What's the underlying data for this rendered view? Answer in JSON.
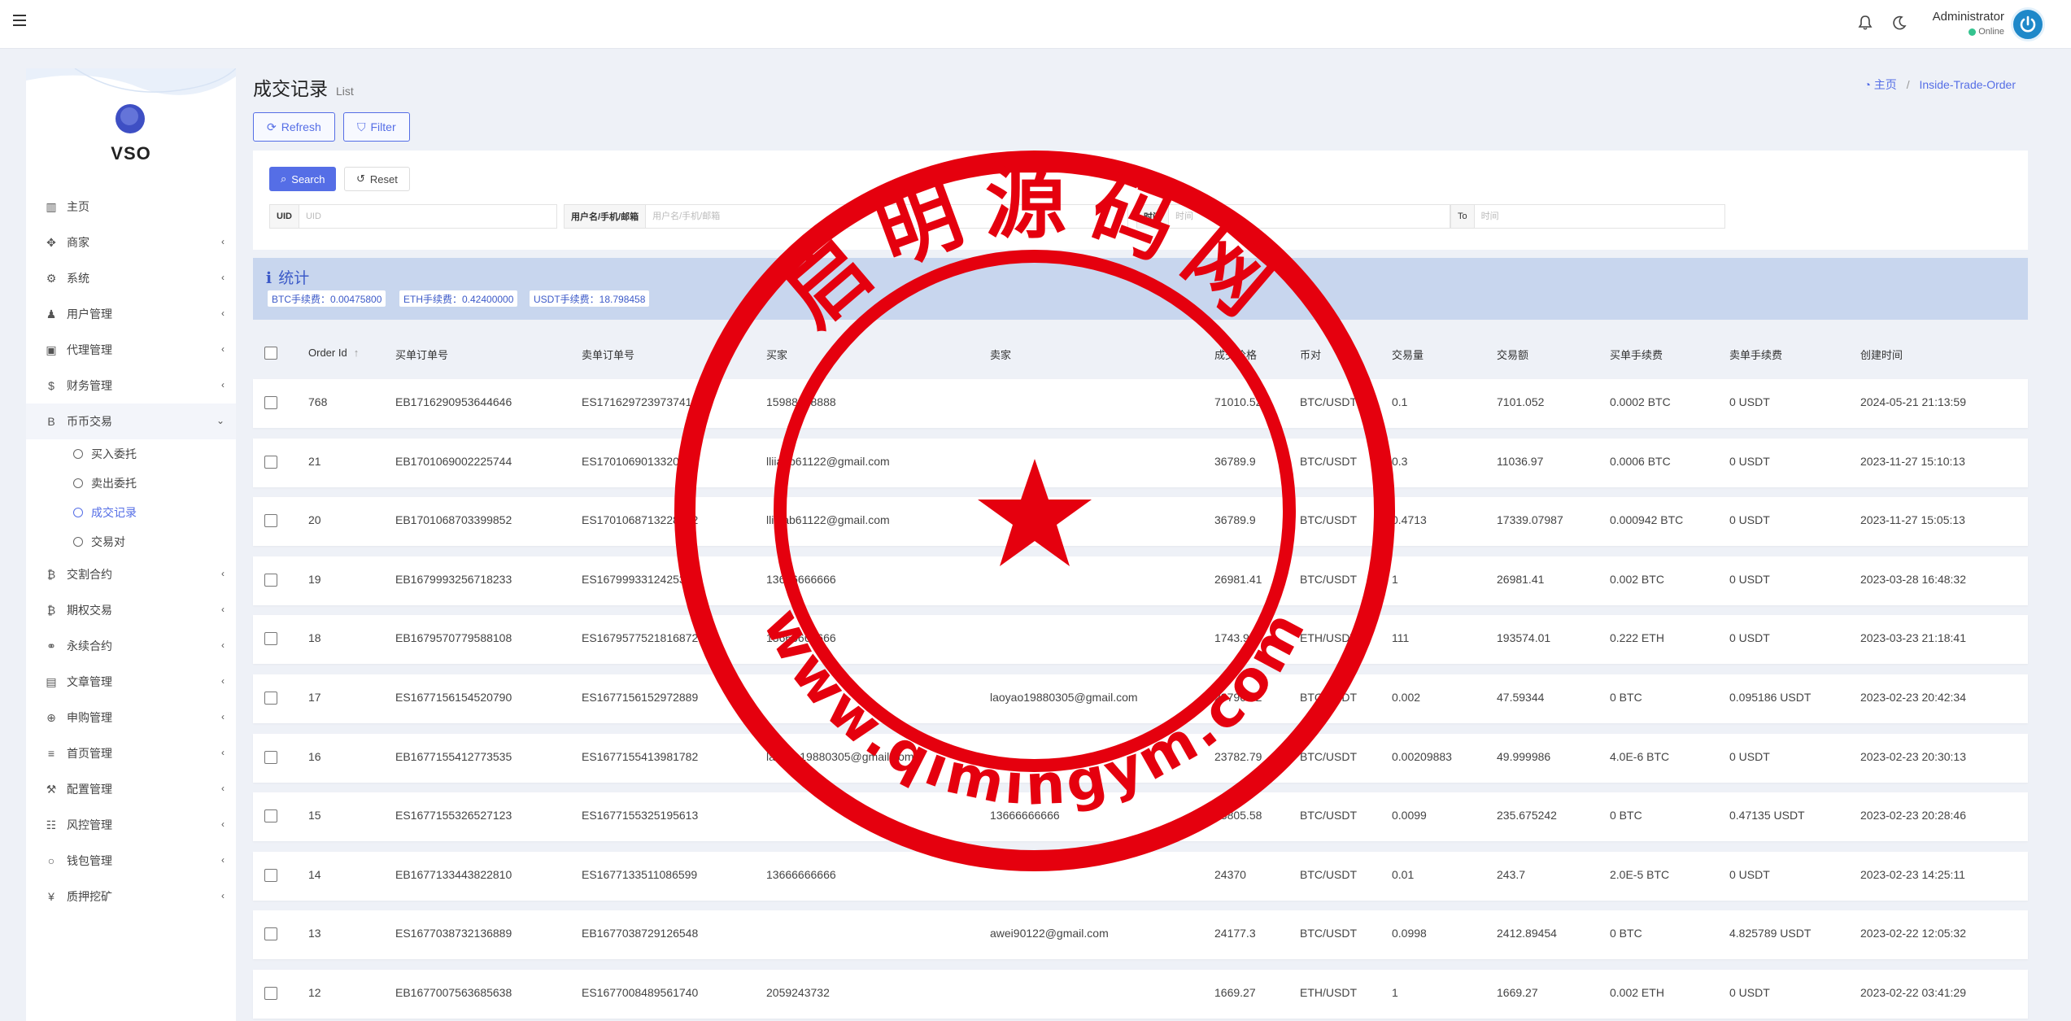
{
  "header": {
    "user_name": "Administrator",
    "user_status": "Online"
  },
  "brand": {
    "name": "VSO"
  },
  "sidebar": {
    "items": [
      {
        "icon": "bar-chart-icon",
        "glyph": "▥",
        "label": "主页",
        "has_children": false
      },
      {
        "icon": "handshake-icon",
        "glyph": "✥",
        "label": "商家",
        "has_children": true
      },
      {
        "icon": "gear-icon",
        "glyph": "⚙",
        "label": "系统",
        "has_children": true
      },
      {
        "icon": "users-icon",
        "glyph": "♟",
        "label": "用户管理",
        "has_children": true
      },
      {
        "icon": "id-card-icon",
        "glyph": "▣",
        "label": "代理管理",
        "has_children": true
      },
      {
        "icon": "dollar-icon",
        "glyph": "$",
        "label": "财务管理",
        "has_children": true
      },
      {
        "icon": "bitcoin-icon",
        "glyph": "B",
        "label": "币币交易",
        "has_children": true,
        "expanded": true
      }
    ],
    "sub_items": [
      {
        "label": "买入委托",
        "current": false
      },
      {
        "label": "卖出委托",
        "current": false
      },
      {
        "label": "成交记录",
        "current": true
      },
      {
        "label": "交易对",
        "current": false
      }
    ],
    "items_after": [
      {
        "icon": "bitcoin-icon",
        "glyph": "₿",
        "label": "交割合约"
      },
      {
        "icon": "bitcoin-icon",
        "glyph": "₿",
        "label": "期权交易"
      },
      {
        "icon": "link-icon",
        "glyph": "⚭",
        "label": "永续合约"
      },
      {
        "icon": "newspaper-icon",
        "glyph": "▤",
        "label": "文章管理"
      },
      {
        "icon": "globe-icon",
        "glyph": "⊕",
        "label": "申购管理"
      },
      {
        "icon": "list-icon",
        "glyph": "≡",
        "label": "首页管理"
      },
      {
        "icon": "wrench-icon",
        "glyph": "⚒",
        "label": "配置管理"
      },
      {
        "icon": "risk-icon",
        "glyph": "☷",
        "label": "风控管理"
      },
      {
        "icon": "circle-icon",
        "glyph": "○",
        "label": "钱包管理"
      },
      {
        "icon": "yen-icon",
        "glyph": "¥",
        "label": "质押挖矿"
      }
    ]
  },
  "page": {
    "title": "成交记录",
    "subtitle": "List"
  },
  "breadcrumb": {
    "home": "主页",
    "current": "Inside-Trade-Order"
  },
  "toolbar": {
    "refresh_label": "Refresh",
    "filter_label": "Filter"
  },
  "filter": {
    "search_label": "Search",
    "reset_label": "Reset",
    "uid_label": "UID",
    "uid_placeholder": "UID",
    "user_label": "用户名/手机/邮箱",
    "user_placeholder": "用户名/手机/邮箱",
    "time_label": "时间",
    "time_placeholder": "时间",
    "to_label": "To",
    "to_placeholder": "时间"
  },
  "stats": {
    "title": "统计",
    "btc_fee": "BTC手续费：0.00475800",
    "eth_fee": "ETH手续费：0.42400000",
    "usdt_fee": "USDT手续费：18.798458"
  },
  "table": {
    "headers": {
      "order_id": "Order Id",
      "buy_no": "买单订单号",
      "sell_no": "卖单订单号",
      "buyer": "买家",
      "seller": "卖家",
      "price": "成交价格",
      "pair": "币对",
      "qty": "交易量",
      "amount": "交易额",
      "buy_fee": "买单手续费",
      "sell_fee": "卖单手续费",
      "created": "创建时间"
    },
    "rows": [
      [
        "768",
        "EB1716290953644646",
        "ES1716297239737415",
        "15988888888",
        "",
        "71010.52",
        "BTC/USDT",
        "0.1",
        "7101.052",
        "0.0002 BTC",
        "0 USDT",
        "2024-05-21 21:13:59"
      ],
      [
        "21",
        "EB1701069002225744",
        "ES1701069013320929",
        "lliiaab61122@gmail.com",
        "",
        "36789.9",
        "BTC/USDT",
        "0.3",
        "11036.97",
        "0.0006 BTC",
        "0 USDT",
        "2023-11-27 15:10:13"
      ],
      [
        "20",
        "EB1701068703399852",
        "ES1701068713228962",
        "lliiaab61122@gmail.com",
        "",
        "36789.9",
        "BTC/USDT",
        "0.4713",
        "17339.07987",
        "0.000942 BTC",
        "0 USDT",
        "2023-11-27 15:05:13"
      ],
      [
        "19",
        "EB1679993256718233",
        "ES1679993312425362",
        "13666666666",
        "",
        "26981.41",
        "BTC/USDT",
        "1",
        "26981.41",
        "0.002 BTC",
        "0 USDT",
        "2023-03-28 16:48:32"
      ],
      [
        "18",
        "EB1679570779588108",
        "ES1679577521816872",
        "13666666666",
        "",
        "1743.91",
        "ETH/USDT",
        "111",
        "193574.01",
        "0.222 ETH",
        "0 USDT",
        "2023-03-23 21:18:41"
      ],
      [
        "17",
        "ES1677156154520790",
        "ES1677156152972889",
        "",
        "laoyao19880305@gmail.com",
        "23796.72",
        "BTC/USDT",
        "0.002",
        "47.59344",
        "0 BTC",
        "0.095186 USDT",
        "2023-02-23 20:42:34"
      ],
      [
        "16",
        "EB1677155412773535",
        "ES1677155413981782",
        "laoyao19880305@gmail.com",
        "",
        "23782.79",
        "BTC/USDT",
        "0.00209883",
        "49.999986",
        "4.0E-6 BTC",
        "0 USDT",
        "2023-02-23 20:30:13"
      ],
      [
        "15",
        "ES1677155326527123",
        "ES1677155325195613",
        "",
        "13666666666",
        "23805.58",
        "BTC/USDT",
        "0.0099",
        "235.675242",
        "0 BTC",
        "0.47135 USDT",
        "2023-02-23 20:28:46"
      ],
      [
        "14",
        "EB1677133443822810",
        "ES1677133511086599",
        "13666666666",
        "",
        "24370",
        "BTC/USDT",
        "0.01",
        "243.7",
        "2.0E-5 BTC",
        "0 USDT",
        "2023-02-23 14:25:11"
      ],
      [
        "13",
        "ES1677038732136889",
        "EB1677038729126548",
        "",
        "awei90122@gmail.com",
        "24177.3",
        "BTC/USDT",
        "0.0998",
        "2412.89454",
        "0 BTC",
        "4.825789 USDT",
        "2023-02-22 12:05:32"
      ],
      [
        "12",
        "EB1677007563685638",
        "ES1677008489561740",
        "2059243732",
        "",
        "1669.27",
        "ETH/USDT",
        "1",
        "1669.27",
        "0.002 ETH",
        "0 USDT",
        "2023-02-22 03:41:29"
      ]
    ]
  },
  "watermark": {
    "top_text": "启明源码网",
    "bottom_text": "www.qimingym.com",
    "color": "#e5000e"
  },
  "colors": {
    "accent": "#556ee6",
    "online": "#34c38f"
  }
}
